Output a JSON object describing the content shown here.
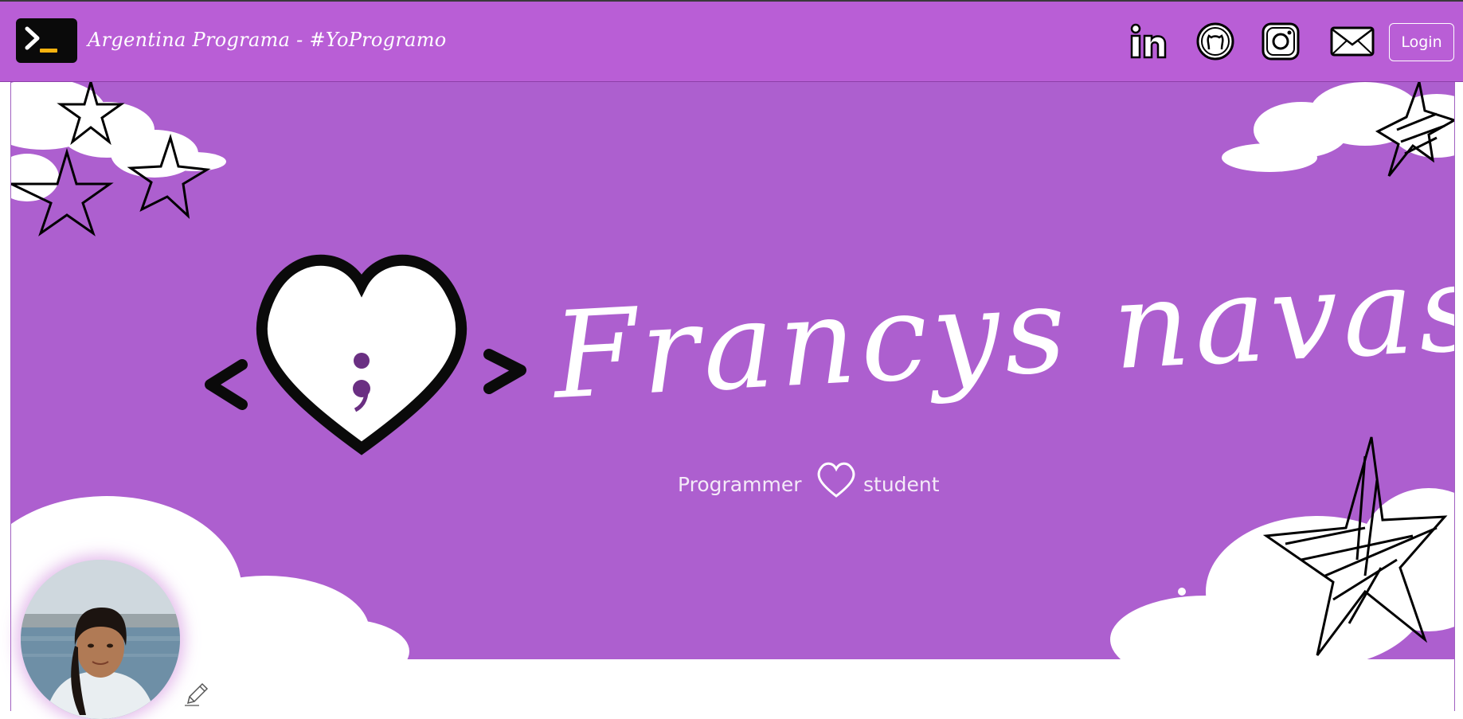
{
  "navbar": {
    "brand": "Argentina Programa - #YoProgramo",
    "login_label": "Login",
    "social_icons": [
      "linkedin-icon",
      "github-icon",
      "instagram-icon",
      "email-icon"
    ]
  },
  "banner": {
    "title": "Francys navas",
    "subtitle_left": "Programmer",
    "subtitle_right": "student"
  },
  "colors": {
    "navbar_bg": "#b95ed6",
    "banner_bg": "#ad5fcf",
    "text": "#ffffff"
  }
}
